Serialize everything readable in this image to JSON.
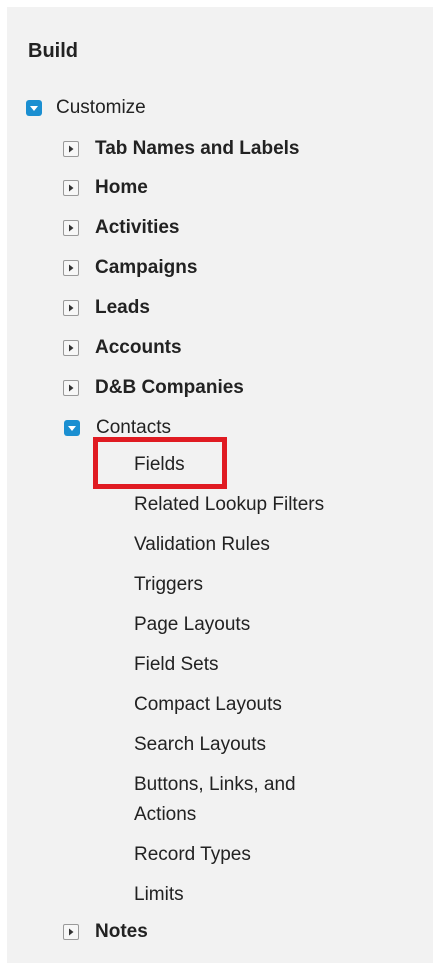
{
  "sidebar": {
    "section_title": "Build",
    "customize": {
      "label": "Customize",
      "expanded": true,
      "items": [
        {
          "label": "Tab Names and Labels",
          "expanded": false
        },
        {
          "label": "Home",
          "expanded": false
        },
        {
          "label": "Activities",
          "expanded": false
        },
        {
          "label": "Campaigns",
          "expanded": false
        },
        {
          "label": "Leads",
          "expanded": false
        },
        {
          "label": "Accounts",
          "expanded": false
        },
        {
          "label": "D&B Companies",
          "expanded": false
        },
        {
          "label": "Contacts",
          "expanded": true
        },
        {
          "label": "Notes",
          "expanded": false
        }
      ],
      "contacts_children": [
        "Fields",
        "Related Lookup Filters",
        "Validation Rules",
        "Triggers",
        "Page Layouts",
        "Field Sets",
        "Compact Layouts",
        "Search Layouts",
        "Buttons, Links, and Actions",
        "Record Types",
        "Limits"
      ]
    }
  },
  "colors": {
    "panel_background": "#f2f2f2",
    "expanded_toggle": "#1b8fd1",
    "highlight_border": "#e01b22",
    "text": "#222222"
  },
  "highlighted_item": "Fields"
}
